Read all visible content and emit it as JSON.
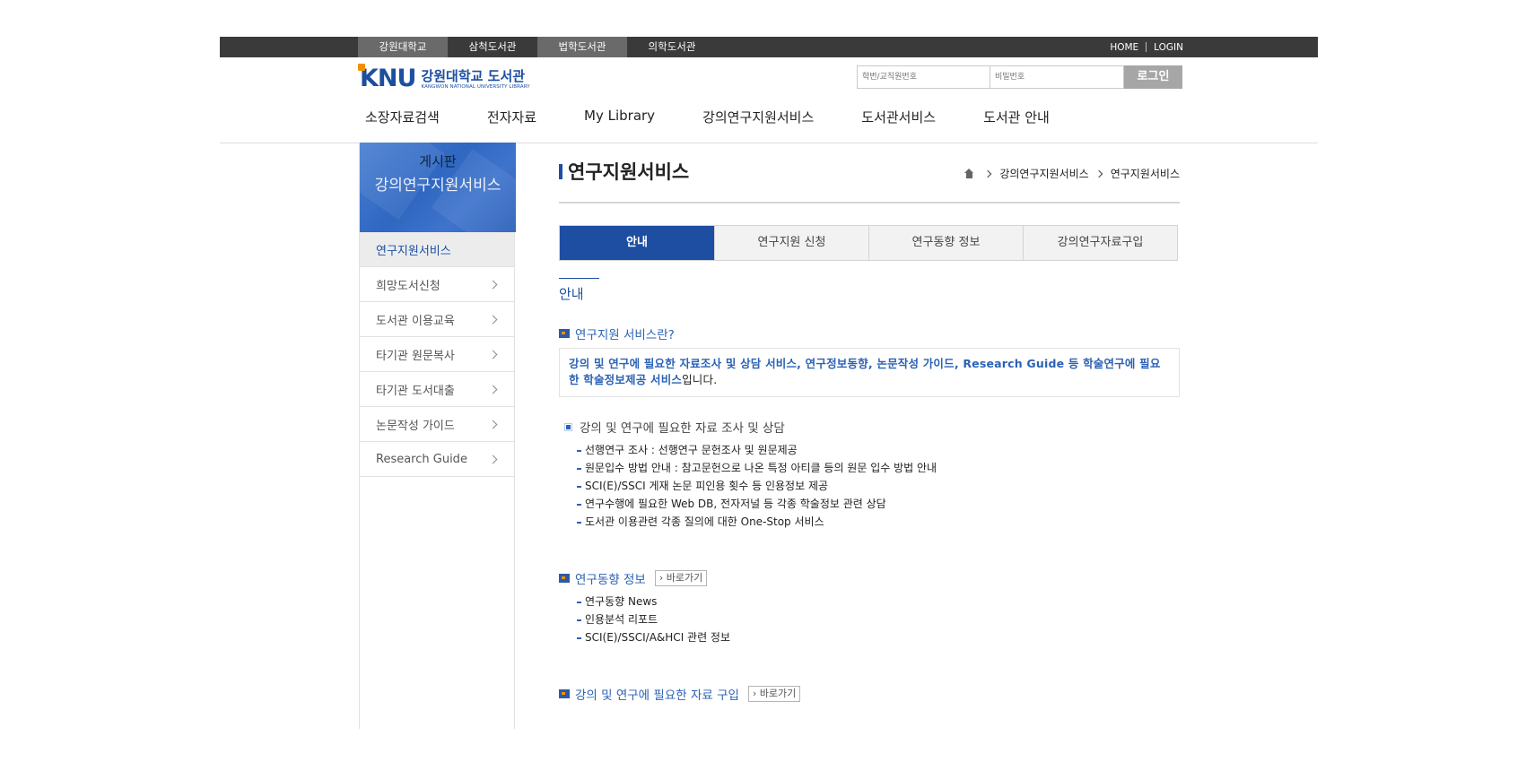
{
  "top_bar": {
    "sites": [
      "강원대학교",
      "삼척도서관",
      "법학도서관",
      "의학도서관"
    ],
    "util": {
      "home": "HOME",
      "login": "LOGIN"
    }
  },
  "logo": {
    "mark": "KNU",
    "name_ko": "강원대학교 도서관",
    "name_en": "KANGWON NATIONAL UNIVERSITY LIBRARY"
  },
  "login_form": {
    "id_placeholder": "학번/교직원번호",
    "pw_placeholder": "비밀번호",
    "button": "로그인"
  },
  "gnb": [
    "소장자료검색",
    "전자자료",
    "My Library",
    "강의연구지원서비스",
    "도서관서비스",
    "도서관 안내"
  ],
  "sidebar": {
    "sup_title": "게시판",
    "title": "강의연구지원서비스",
    "items": [
      "연구지원서비스",
      "희망도서신청",
      "도서관 이용교육",
      "타기관 원문복사",
      "타기관 도서대출",
      "논문작성 가이드",
      "Research Guide"
    ]
  },
  "content": {
    "page_title": "연구지원서비스",
    "breadcrumb": [
      "강의연구지원서비스",
      "연구지원서비스"
    ],
    "tabs": [
      "안내",
      "연구지원 신청",
      "연구동향 정보",
      "강의연구자료구입"
    ],
    "section_title": "안내",
    "q1": {
      "title": "연구지원 서비스란?",
      "highlight": "강의 및 연구에 필요한 자료조사 및 상담 서비스, 연구정보동향, 논문작성 가이드, Research Guide 등 학술연구에 필요한 학술정보제공 서비스",
      "suffix": "입니다."
    },
    "sub1": {
      "title": "강의 및 연구에 필요한 자료 조사 및 상담",
      "items": [
        "선행연구 조사 : 선행연구 문헌조사 및 원문제공",
        "원문입수 방법 안내 : 참고문헌으로 나온 특정 아티클 등의 원문 입수 방법 안내",
        "SCI(E)/SSCI 게재 논문 피인용 횟수 등 인용정보 제공",
        "연구수행에 필요한 Web DB, 전자저널 등 각종 학술정보 관련 상담",
        "도서관 이용관련 각종 질의에 대한 One-Stop 서비스"
      ]
    },
    "q2": {
      "title": "연구동향 정보",
      "go": "› 바로가기",
      "items": [
        "연구동향 News",
        "인용분석 리포트",
        "SCI(E)/SSCI/A&HCI 관련 정보"
      ]
    },
    "q3": {
      "title": "강의 및 연구에 필요한 자료 구입",
      "go": "› 바로가기"
    }
  }
}
